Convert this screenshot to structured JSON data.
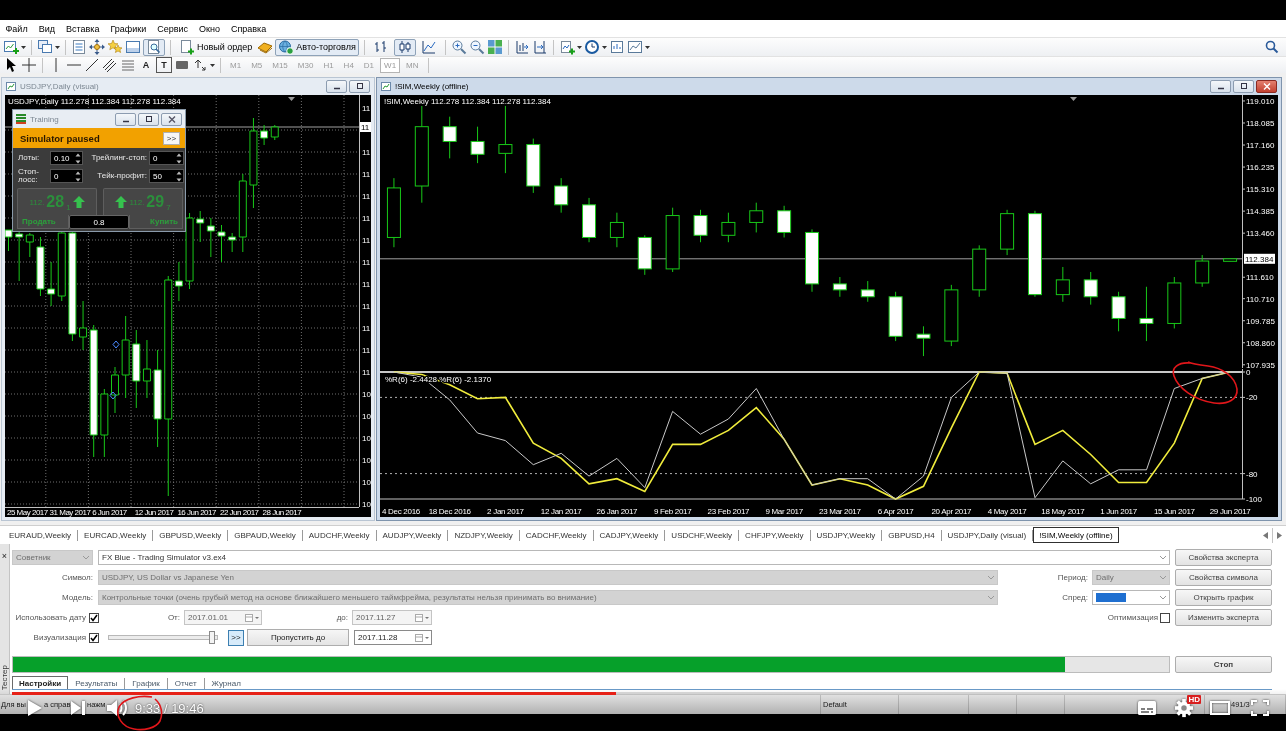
{
  "menu": [
    "Файл",
    "Вид",
    "Вставка",
    "Графики",
    "Сервис",
    "Окно",
    "Справка"
  ],
  "toolbar": {
    "strategy_tester": {
      "on": true
    },
    "new_order": "Новый ордер",
    "autotrading": {
      "label": "Авто-торговля",
      "on": true
    },
    "chart_types": [
      {
        "selected": false
      },
      {
        "selected": true
      },
      {
        "selected": false
      }
    ],
    "text_tool": "A",
    "label_tool": "T",
    "timeframes": [
      {
        "label": "M1",
        "selected": false
      },
      {
        "label": "M5",
        "selected": false
      },
      {
        "label": "M15",
        "selected": false
      },
      {
        "label": "M30",
        "selected": false
      },
      {
        "label": "H1",
        "selected": false
      },
      {
        "label": "H4",
        "selected": false
      },
      {
        "label": "D1",
        "selected": false
      },
      {
        "label": "W1",
        "selected": true
      },
      {
        "label": "MN",
        "selected": false
      }
    ]
  },
  "left_window": {
    "title": "USDJPY,Daily (visual)",
    "active": false,
    "window_buttons": [
      {
        "kind": "minimize"
      },
      {
        "kind": "restore"
      }
    ],
    "info": "USDJPY,Daily 112.278 112.384 112.278 112.384",
    "price_labels": [
      "11",
      "11",
      "11",
      "11",
      "11",
      "11",
      "11",
      "11",
      "11",
      "11",
      "11",
      "11",
      "10",
      "10",
      "10",
      "10",
      "10",
      "10"
    ],
    "price_tag": "11",
    "date_labels": [
      "25 May 2017",
      "31 May 2017",
      "6 Jun 2017",
      "12 Jun 2017",
      "16 Jun 2017",
      "22 Jun 2017",
      "28 Jun 2017"
    ]
  },
  "training": {
    "title": "Training",
    "active": false,
    "window_buttons": [
      {
        "kind": "minimize"
      },
      {
        "kind": "restore"
      },
      {
        "kind": "close"
      }
    ],
    "status": "Simulator paused",
    "resume": ">>",
    "fields": [
      {
        "label": "Лоты:",
        "value": "0.10"
      },
      {
        "label": "Трейлинг-стоп:",
        "value": "0"
      },
      {
        "label": "Стоп-лосс:",
        "value": "0"
      },
      {
        "label": "Тейк-профит:",
        "value": "50"
      }
    ],
    "sell": {
      "price_head": "112.",
      "price_pips": "28",
      "price_tail": "1",
      "label": "Продать"
    },
    "buy": {
      "price_head": "112.",
      "price_pips": "29",
      "price_tail": "7",
      "label": "Купить"
    },
    "lots": "0.8"
  },
  "right_window": {
    "title": "!SIM,Weekly (offline)",
    "active": true,
    "window_buttons": [
      {
        "kind": "minimize"
      },
      {
        "kind": "restore"
      },
      {
        "kind": "close"
      }
    ],
    "chart_data": [
      {
        "type": "candlestick",
        "title": "!SIM,Weekly 112.278 112.384 112.278 112.384",
        "ohlc": [
          [
            113.28,
            115.77,
            112.87,
            115.36
          ],
          [
            115.44,
            118.8,
            114.74,
            117.93
          ],
          [
            117.93,
            118.35,
            116.6,
            117.31
          ],
          [
            117.31,
            117.93,
            116.4,
            116.77
          ],
          [
            116.81,
            118.8,
            115.98,
            117.18
          ],
          [
            117.18,
            117.43,
            115.15,
            115.44
          ],
          [
            115.44,
            115.77,
            114.32,
            114.65
          ],
          [
            114.65,
            114.94,
            113.08,
            113.28
          ],
          [
            113.28,
            114.32,
            112.87,
            113.91
          ],
          [
            113.28,
            113.37,
            111.71,
            111.96
          ],
          [
            111.96,
            114.53,
            111.83,
            114.2
          ],
          [
            114.2,
            114.44,
            113.08,
            113.37
          ],
          [
            113.37,
            114.32,
            113.08,
            113.91
          ],
          [
            113.91,
            114.74,
            113.49,
            114.4
          ],
          [
            114.4,
            114.61,
            113.28,
            113.49
          ],
          [
            113.49,
            113.62,
            111.0,
            111.33
          ],
          [
            111.33,
            111.62,
            110.79,
            111.08
          ],
          [
            111.08,
            111.45,
            110.58,
            110.79
          ],
          [
            110.79,
            111.0,
            108.93,
            109.13
          ],
          [
            109.22,
            109.55,
            108.3,
            109.05
          ],
          [
            108.93,
            111.29,
            108.72,
            111.08
          ],
          [
            111.08,
            112.95,
            110.79,
            112.79
          ],
          [
            112.79,
            114.44,
            112.54,
            114.28
          ],
          [
            114.28,
            114.4,
            110.79,
            110.88
          ],
          [
            110.88,
            112.04,
            110.58,
            111.5
          ],
          [
            111.5,
            111.83,
            110.46,
            110.79
          ],
          [
            110.79,
            111.0,
            109.34,
            109.88
          ],
          [
            109.88,
            111.21,
            108.93,
            109.67
          ],
          [
            109.67,
            111.62,
            109.46,
            111.37
          ],
          [
            111.37,
            112.54,
            111.21,
            112.29
          ],
          [
            112.278,
            112.384,
            112.278,
            112.384
          ]
        ],
        "ylim": [
          107.8,
          119.26
        ],
        "yticks": [
          {
            "value": 119.01,
            "label": "119.010"
          },
          {
            "value": 118.085,
            "label": "118.085"
          },
          {
            "value": 117.16,
            "label": "117.160"
          },
          {
            "value": 116.235,
            "label": "116.235"
          },
          {
            "value": 115.31,
            "label": "115.310"
          },
          {
            "value": 114.385,
            "label": "114.385"
          },
          {
            "value": 113.46,
            "label": "113.460"
          },
          {
            "value": 111.61,
            "label": "111.610"
          },
          {
            "value": 110.71,
            "label": "110.710"
          },
          {
            "value": 109.785,
            "label": "109.785"
          },
          {
            "value": 108.86,
            "label": "108.860"
          },
          {
            "value": 107.935,
            "label": "107.935"
          }
        ],
        "ref_lines": [
          {
            "axis": "y",
            "value": 112.384,
            "label": "112.384",
            "color": "#a0a0a0"
          }
        ]
      },
      {
        "type": "line",
        "title": "%R(6) -2.4428 %R(6) -2.1370",
        "categories": [
          "4 Dec 2016",
          null,
          "18 Dec 2016",
          null,
          "2 Jan 2017",
          null,
          "12 Jan 2017",
          null,
          "26 Jan 2017",
          null,
          "9 Feb 2017",
          null,
          "23 Feb 2017",
          null,
          "9 Mar 2017",
          null,
          "23 Mar 2017",
          null,
          "6 Apr 2017",
          null,
          "20 Apr 2017",
          null,
          "4 May 2017",
          null,
          "18 May 2017",
          null,
          "1 Jun 2017",
          null,
          "15 Jun 2017",
          null,
          "29 Jun 2017"
        ],
        "series": [
          {
            "color": "#f0ec3c",
            "values": [
              0,
              -2,
              -10,
              -21,
              -20,
              -56,
              -68,
              -88,
              -84,
              -94,
              -57,
              -57,
              -46,
              -28,
              -53,
              -89,
              -84,
              -89,
              -100,
              -90,
              -44,
              0,
              -1,
              -57,
              -46,
              -65,
              -87,
              -87,
              -56,
              -5,
              0
            ]
          },
          {
            "color": "#c8c8c8",
            "values": [
              0,
              -4,
              -22,
              -48,
              -54,
              -73,
              -64,
              -82,
              -68,
              -91,
              -31,
              -49,
              -37,
              -13,
              -53,
              -89,
              -84,
              -84,
              -100,
              -82,
              -20,
              0,
              -1,
              -99,
              -70,
              -88,
              -77,
              -77,
              -13,
              -5,
              0
            ]
          }
        ],
        "ylim": [
          -100,
          0
        ],
        "yticks": [
          0,
          -20,
          -80,
          -100
        ],
        "ref_lines": [
          {
            "axis": "y",
            "value": -20,
            "color": "#b0b0b0",
            "line_style": "dotted"
          },
          {
            "axis": "y",
            "value": -80,
            "color": "#b0b0b0",
            "line_style": "dotted"
          }
        ]
      }
    ]
  },
  "chart_tabs": [
    {
      "label": "EURAUD,Weekly",
      "selected": false
    },
    {
      "label": "EURCAD,Weekly",
      "selected": false
    },
    {
      "label": "GBPUSD,Weekly",
      "selected": false
    },
    {
      "label": "GBPAUD,Weekly",
      "selected": false
    },
    {
      "label": "AUDCHF,Weekly",
      "selected": false
    },
    {
      "label": "AUDJPY,Weekly",
      "selected": false
    },
    {
      "label": "NZDJPY,Weekly",
      "selected": false
    },
    {
      "label": "CADCHF,Weekly",
      "selected": false
    },
    {
      "label": "CADJPY,Weekly",
      "selected": false
    },
    {
      "label": "USDCHF,Weekly",
      "selected": false
    },
    {
      "label": "CHFJPY,Weekly",
      "selected": false
    },
    {
      "label": "USDJPY,Weekly",
      "selected": false
    },
    {
      "label": "GBPUSD,H4",
      "selected": false
    },
    {
      "label": "USDJPY,Daily (visual)",
      "selected": false
    },
    {
      "label": "!SIM,Weekly (offline)",
      "selected": true
    }
  ],
  "tester": {
    "side_label": "Тестер",
    "close_glyph": "×",
    "expert_type": {
      "value": "Советник",
      "disabled": true
    },
    "expert": {
      "value": "FX Blue - Trading Simulator v3.ex4",
      "disabled": false
    },
    "symbol": {
      "label": "Символ:",
      "value": "USDJPY, US Dollar vs Japanese Yen",
      "disabled": true
    },
    "period": {
      "label": "Период:",
      "value": "Daily",
      "disabled": true
    },
    "model": {
      "label": "Модель:",
      "value": "Контрольные точки (очень грубый метод на основе ближайшего меньшего таймфрейма, результаты нельзя принимать во внимание)",
      "disabled": true
    },
    "spread": {
      "label": "Спред:",
      "highlighted": true
    },
    "use_date": {
      "label": "Использовать дату",
      "checked": true
    },
    "from": {
      "label": "От:",
      "value": "2017.01.01",
      "disabled": true
    },
    "to": {
      "label": "до:",
      "value": "2017.11.27",
      "disabled": true
    },
    "optimization": {
      "label": "Оптимизация",
      "checked": false
    },
    "visualization": {
      "label": "Визуализация",
      "checked": true
    },
    "speed": {
      "level": 0.95
    },
    "step_button": ">>",
    "skip_to": {
      "button": "Пропустить до",
      "value": "2017.11.28"
    },
    "progress": {
      "level": 0.91
    },
    "side_buttons": [
      "Свойства эксперта",
      "Свойства символа",
      "Открыть график",
      "Изменить эксперта"
    ],
    "stop": "Стоп",
    "tabs": [
      {
        "label": "Настройки",
        "selected": true
      },
      {
        "label": "Результаты",
        "selected": false
      },
      {
        "label": "График",
        "selected": false
      },
      {
        "label": "Отчет",
        "selected": false
      },
      {
        "label": "Журнал",
        "selected": false
      }
    ]
  },
  "status_bar": {
    "help_fragments": [
      "Для вы",
      "а справ",
      "нажм"
    ],
    "profile": "Default",
    "traffic": "491/3"
  },
  "video_player": {
    "level": 0.48,
    "time": "9:33 / 19:46",
    "quality_badge": "HD"
  }
}
